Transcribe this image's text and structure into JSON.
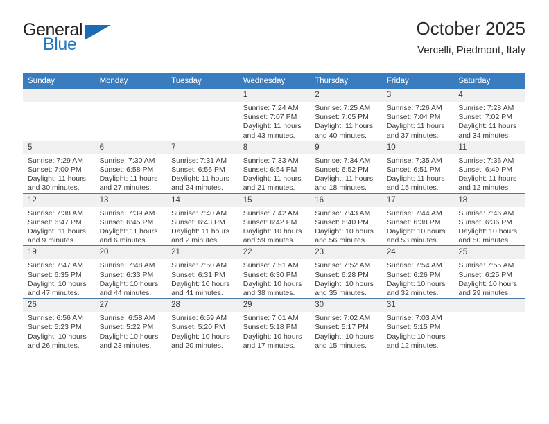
{
  "brand": {
    "name_top": "General",
    "name_bottom": "Blue",
    "accent_color": "#2079c4",
    "triangle_color": "#1b6cb5"
  },
  "header": {
    "title": "October 2025",
    "subtitle": "Vercelli, Piedmont, Italy"
  },
  "theme": {
    "header_bg": "#3a7cc0",
    "daynum_bg": "#f0f0f0",
    "rule_color": "#4a79a8",
    "text_color": "#3b3b3b"
  },
  "weekdays": [
    "Sunday",
    "Monday",
    "Tuesday",
    "Wednesday",
    "Thursday",
    "Friday",
    "Saturday"
  ],
  "weeks": [
    [
      {
        "day": "",
        "sunrise": "",
        "sunset": "",
        "daylight": "",
        "empty": true
      },
      {
        "day": "",
        "sunrise": "",
        "sunset": "",
        "daylight": "",
        "empty": true
      },
      {
        "day": "",
        "sunrise": "",
        "sunset": "",
        "daylight": "",
        "empty": true
      },
      {
        "day": "1",
        "sunrise": "Sunrise: 7:24 AM",
        "sunset": "Sunset: 7:07 PM",
        "daylight": "Daylight: 11 hours and 43 minutes."
      },
      {
        "day": "2",
        "sunrise": "Sunrise: 7:25 AM",
        "sunset": "Sunset: 7:05 PM",
        "daylight": "Daylight: 11 hours and 40 minutes."
      },
      {
        "day": "3",
        "sunrise": "Sunrise: 7:26 AM",
        "sunset": "Sunset: 7:04 PM",
        "daylight": "Daylight: 11 hours and 37 minutes."
      },
      {
        "day": "4",
        "sunrise": "Sunrise: 7:28 AM",
        "sunset": "Sunset: 7:02 PM",
        "daylight": "Daylight: 11 hours and 34 minutes."
      }
    ],
    [
      {
        "day": "5",
        "sunrise": "Sunrise: 7:29 AM",
        "sunset": "Sunset: 7:00 PM",
        "daylight": "Daylight: 11 hours and 30 minutes."
      },
      {
        "day": "6",
        "sunrise": "Sunrise: 7:30 AM",
        "sunset": "Sunset: 6:58 PM",
        "daylight": "Daylight: 11 hours and 27 minutes."
      },
      {
        "day": "7",
        "sunrise": "Sunrise: 7:31 AM",
        "sunset": "Sunset: 6:56 PM",
        "daylight": "Daylight: 11 hours and 24 minutes."
      },
      {
        "day": "8",
        "sunrise": "Sunrise: 7:33 AM",
        "sunset": "Sunset: 6:54 PM",
        "daylight": "Daylight: 11 hours and 21 minutes."
      },
      {
        "day": "9",
        "sunrise": "Sunrise: 7:34 AM",
        "sunset": "Sunset: 6:52 PM",
        "daylight": "Daylight: 11 hours and 18 minutes."
      },
      {
        "day": "10",
        "sunrise": "Sunrise: 7:35 AM",
        "sunset": "Sunset: 6:51 PM",
        "daylight": "Daylight: 11 hours and 15 minutes."
      },
      {
        "day": "11",
        "sunrise": "Sunrise: 7:36 AM",
        "sunset": "Sunset: 6:49 PM",
        "daylight": "Daylight: 11 hours and 12 minutes."
      }
    ],
    [
      {
        "day": "12",
        "sunrise": "Sunrise: 7:38 AM",
        "sunset": "Sunset: 6:47 PM",
        "daylight": "Daylight: 11 hours and 9 minutes."
      },
      {
        "day": "13",
        "sunrise": "Sunrise: 7:39 AM",
        "sunset": "Sunset: 6:45 PM",
        "daylight": "Daylight: 11 hours and 6 minutes."
      },
      {
        "day": "14",
        "sunrise": "Sunrise: 7:40 AM",
        "sunset": "Sunset: 6:43 PM",
        "daylight": "Daylight: 11 hours and 2 minutes."
      },
      {
        "day": "15",
        "sunrise": "Sunrise: 7:42 AM",
        "sunset": "Sunset: 6:42 PM",
        "daylight": "Daylight: 10 hours and 59 minutes."
      },
      {
        "day": "16",
        "sunrise": "Sunrise: 7:43 AM",
        "sunset": "Sunset: 6:40 PM",
        "daylight": "Daylight: 10 hours and 56 minutes."
      },
      {
        "day": "17",
        "sunrise": "Sunrise: 7:44 AM",
        "sunset": "Sunset: 6:38 PM",
        "daylight": "Daylight: 10 hours and 53 minutes."
      },
      {
        "day": "18",
        "sunrise": "Sunrise: 7:46 AM",
        "sunset": "Sunset: 6:36 PM",
        "daylight": "Daylight: 10 hours and 50 minutes."
      }
    ],
    [
      {
        "day": "19",
        "sunrise": "Sunrise: 7:47 AM",
        "sunset": "Sunset: 6:35 PM",
        "daylight": "Daylight: 10 hours and 47 minutes."
      },
      {
        "day": "20",
        "sunrise": "Sunrise: 7:48 AM",
        "sunset": "Sunset: 6:33 PM",
        "daylight": "Daylight: 10 hours and 44 minutes."
      },
      {
        "day": "21",
        "sunrise": "Sunrise: 7:50 AM",
        "sunset": "Sunset: 6:31 PM",
        "daylight": "Daylight: 10 hours and 41 minutes."
      },
      {
        "day": "22",
        "sunrise": "Sunrise: 7:51 AM",
        "sunset": "Sunset: 6:30 PM",
        "daylight": "Daylight: 10 hours and 38 minutes."
      },
      {
        "day": "23",
        "sunrise": "Sunrise: 7:52 AM",
        "sunset": "Sunset: 6:28 PM",
        "daylight": "Daylight: 10 hours and 35 minutes."
      },
      {
        "day": "24",
        "sunrise": "Sunrise: 7:54 AM",
        "sunset": "Sunset: 6:26 PM",
        "daylight": "Daylight: 10 hours and 32 minutes."
      },
      {
        "day": "25",
        "sunrise": "Sunrise: 7:55 AM",
        "sunset": "Sunset: 6:25 PM",
        "daylight": "Daylight: 10 hours and 29 minutes."
      }
    ],
    [
      {
        "day": "26",
        "sunrise": "Sunrise: 6:56 AM",
        "sunset": "Sunset: 5:23 PM",
        "daylight": "Daylight: 10 hours and 26 minutes."
      },
      {
        "day": "27",
        "sunrise": "Sunrise: 6:58 AM",
        "sunset": "Sunset: 5:22 PM",
        "daylight": "Daylight: 10 hours and 23 minutes."
      },
      {
        "day": "28",
        "sunrise": "Sunrise: 6:59 AM",
        "sunset": "Sunset: 5:20 PM",
        "daylight": "Daylight: 10 hours and 20 minutes."
      },
      {
        "day": "29",
        "sunrise": "Sunrise: 7:01 AM",
        "sunset": "Sunset: 5:18 PM",
        "daylight": "Daylight: 10 hours and 17 minutes."
      },
      {
        "day": "30",
        "sunrise": "Sunrise: 7:02 AM",
        "sunset": "Sunset: 5:17 PM",
        "daylight": "Daylight: 10 hours and 15 minutes."
      },
      {
        "day": "31",
        "sunrise": "Sunrise: 7:03 AM",
        "sunset": "Sunset: 5:15 PM",
        "daylight": "Daylight: 10 hours and 12 minutes."
      },
      {
        "day": "",
        "sunrise": "",
        "sunset": "",
        "daylight": "",
        "empty": true
      }
    ]
  ]
}
